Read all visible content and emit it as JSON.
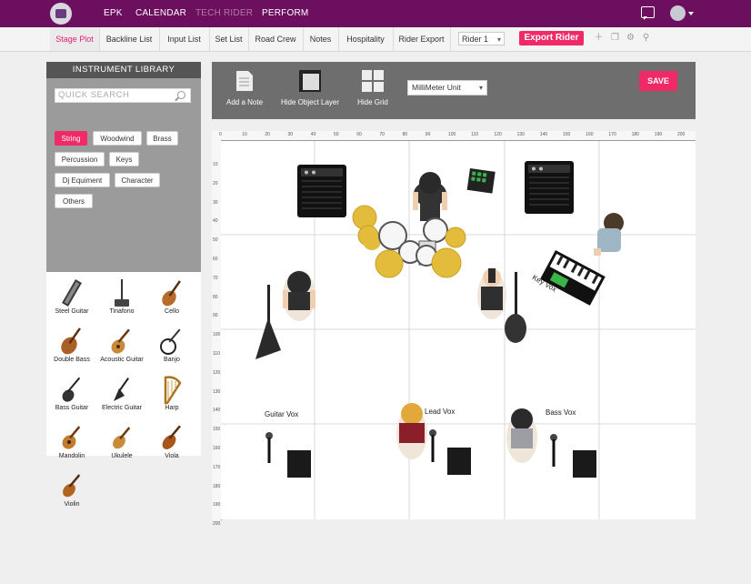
{
  "nav": {
    "epk": "EPK",
    "calendar": "CALENDAR",
    "tech_rider": "TECH RIDER",
    "perform": "PERFORM"
  },
  "tabs": [
    "Stage Plot",
    "Backline List",
    "Input List",
    "Set List",
    "Road Crew",
    "Notes",
    "Hospitality",
    "Rider Export"
  ],
  "rider_select": "Rider 1",
  "export_label": "Export Rider",
  "library": {
    "title": "INSTRUMENT LIBRARY",
    "search_placeholder": "QUICK SEARCH",
    "categories": [
      "String",
      "Woodwind",
      "Brass",
      "Percussion",
      "Keys",
      "Dj Equiment",
      "Character",
      "Others"
    ],
    "instruments": [
      "Steel Guitar",
      "Tinafono",
      "Cello",
      "Double Bass",
      "Acoustic Guitar",
      "Banjo",
      "Bass Guitar",
      "Electric Guitar",
      "Harp",
      "Mandolin",
      "Ukulele",
      "Viola",
      "Violin"
    ]
  },
  "toolbar": {
    "add_note": "Add a Note",
    "hide_object_layer": "Hide Object Layer",
    "hide_grid": "Hide Grid",
    "unit": "MilliMeter Unit",
    "save": "SAVE"
  },
  "ruler": {
    "top": [
      "0",
      "10",
      "20",
      "30",
      "40",
      "50",
      "60",
      "70",
      "80",
      "90",
      "100",
      "110",
      "120",
      "130",
      "140",
      "150",
      "160",
      "170",
      "180",
      "190",
      "200"
    ],
    "left": [
      "10",
      "20",
      "30",
      "40",
      "50",
      "60",
      "70",
      "80",
      "90",
      "100",
      "110",
      "120",
      "130",
      "140",
      "150",
      "160",
      "170",
      "180",
      "190",
      "200"
    ]
  },
  "stage_labels": {
    "key_vox": "Key Vox",
    "guitar_vox": "Guitar Vox",
    "lead_vox": "Lead Vox",
    "bass_vox": "Bass Vox"
  },
  "colors": {
    "brand": "#6b0f5e",
    "accent": "#ef2a67",
    "cymbal": "#e3bc3c"
  }
}
